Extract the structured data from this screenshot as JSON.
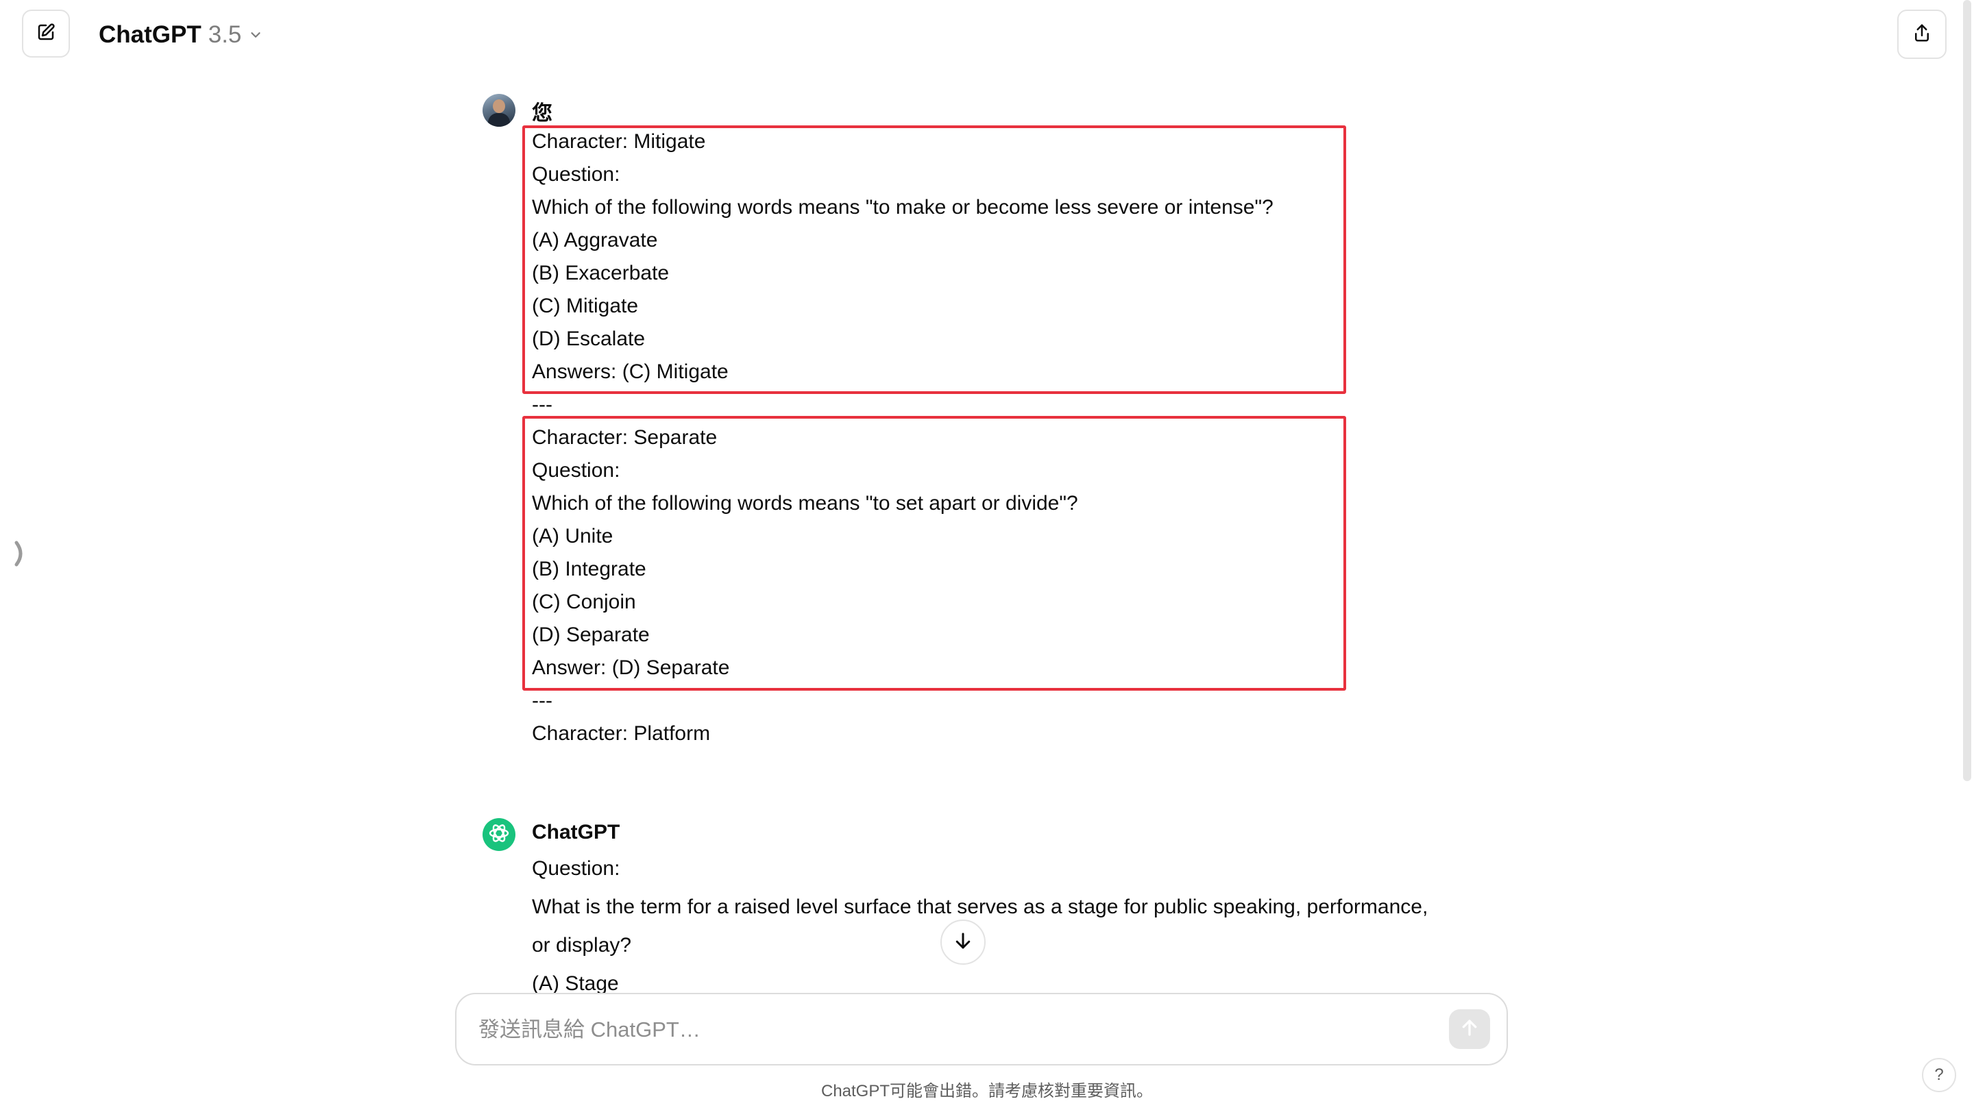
{
  "header": {
    "model_name": "ChatGPT",
    "model_version": "3.5"
  },
  "user_message": {
    "author": "您",
    "lines": [
      "Character: Mitigate",
      "Question:",
      "Which of the following words means \"to make or become less severe or intense\"?",
      "(A) Aggravate",
      "(B) Exacerbate",
      "(C) Mitigate",
      "(D) Escalate",
      "Answers:  (C) Mitigate",
      "---",
      "Character: Separate",
      "Question:",
      "Which of the following words means \"to set apart or divide\"?",
      "(A) Unite",
      "(B) Integrate",
      "(C) Conjoin",
      "(D) Separate",
      "Answer: (D) Separate",
      "---",
      "Character: Platform"
    ]
  },
  "assistant_message": {
    "author": "ChatGPT",
    "lines": [
      "Question:",
      "What is the term for a raised level surface that serves as a stage for public speaking, performance,",
      "or display?",
      "(A) Stage"
    ]
  },
  "composer": {
    "placeholder": "發送訊息給 ChatGPT…"
  },
  "footer": {
    "disclaimer": "ChatGPT可能會出錯。請考慮核對重要資訊。",
    "help_label": "?"
  },
  "colors": {
    "highlight_box": "#e8313e",
    "assistant_avatar": "#19c37d"
  }
}
